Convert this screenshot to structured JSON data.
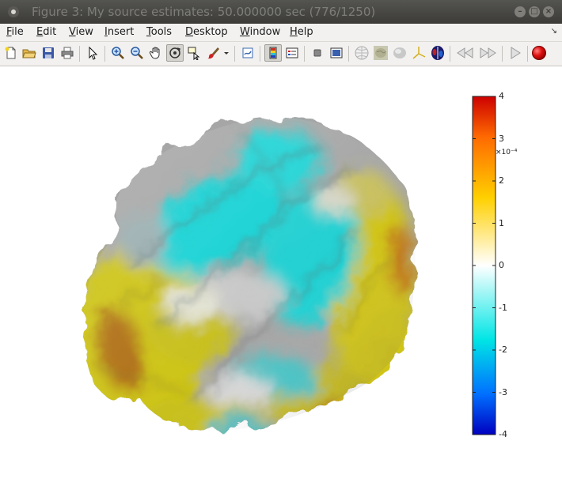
{
  "window": {
    "title": "Figure 3: My source estimates:  50.000000 sec  (776/1250)"
  },
  "menu": {
    "items": [
      {
        "key": "F",
        "rest": "ile"
      },
      {
        "key": "E",
        "rest": "dit"
      },
      {
        "key": "V",
        "rest": "iew"
      },
      {
        "key": "I",
        "rest": "nsert"
      },
      {
        "key": "T",
        "rest": "ools"
      },
      {
        "key": "D",
        "rest": "esktop"
      },
      {
        "key": "W",
        "rest": "indow"
      },
      {
        "key": "H",
        "rest": "elp"
      }
    ]
  },
  "toolbar": {
    "icons": [
      "new-figure-icon",
      "open-file-icon",
      "save-icon",
      "print-icon",
      "select-arrow-icon",
      "zoom-in-icon",
      "zoom-out-icon",
      "pan-hand-icon",
      "rotate-3d-icon",
      "data-cursor-icon",
      "brush-icon",
      "brush-dropdown-icon",
      "link-plot-icon",
      "colorbar-icon",
      "legend-icon",
      "hide-plot-tools-icon",
      "show-plot-tools-icon",
      "brain-sphere-icon",
      "brain-smooth-icon",
      "brain-surface-icon",
      "axes-icon",
      "brain-hemispheres-icon",
      "rewind-icon",
      "fast-forward-icon",
      "play-icon",
      "record-icon"
    ]
  },
  "colorbar": {
    "exponent": "×10⁻⁴",
    "ticks": [
      "4",
      "3",
      "2",
      "1",
      "0",
      "-1",
      "-2",
      "-3",
      "-4"
    ],
    "colors": [
      "#cc0000",
      "#ff6a00",
      "#ffd000",
      "#ffffff",
      "#00e5e5",
      "#0070ff",
      "#0000c0"
    ]
  },
  "colors": {
    "cyan": "#1ed2d4",
    "gray": "#a8a8a8",
    "yellow": "#d4cc1e",
    "orange": "#c06a16"
  }
}
